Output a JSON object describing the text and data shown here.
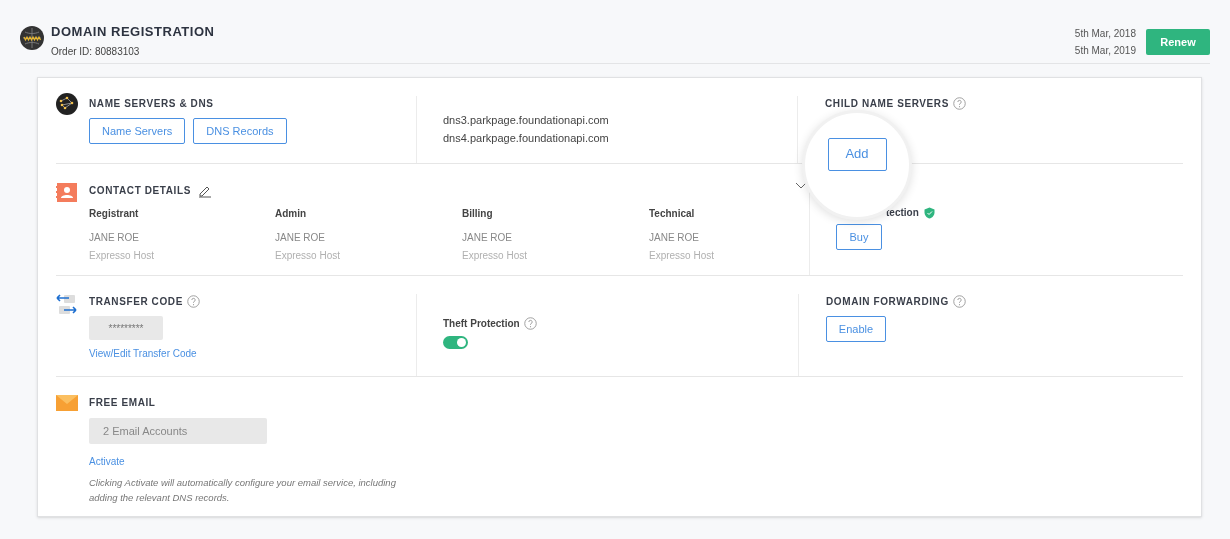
{
  "header": {
    "title": "DOMAIN REGISTRATION",
    "order_id": "Order ID: 80883103",
    "dates": [
      "5th Mar, 2018",
      "5th Mar, 2019"
    ],
    "renew_button": "Renew"
  },
  "name_servers": {
    "title": "NAME SERVERS & DNS",
    "buttons": [
      "Name Servers",
      "DNS Records"
    ],
    "servers": [
      "dns3.parkpage.foundationapi.com",
      "dns4.parkpage.foundationapi.com"
    ]
  },
  "child_name_servers": {
    "title": "CHILD NAME SERVERS",
    "button": "Add"
  },
  "contact_details": {
    "title": "CONTACT DETAILS",
    "contacts": [
      {
        "role": "Registrant",
        "name": "JANE ROE",
        "company": "Expresso Host"
      },
      {
        "role": "Admin",
        "name": "JANE ROE",
        "company": "Expresso Host"
      },
      {
        "role": "Billing",
        "name": "JANE ROE",
        "company": "Expresso Host"
      },
      {
        "role": "Technical",
        "name": "JANE ROE",
        "company": "Expresso Host"
      }
    ]
  },
  "privacy": {
    "title": "tection",
    "button": "Buy"
  },
  "transfer_code": {
    "title": "TRANSFER CODE",
    "value": "*********",
    "link": "View/Edit Transfer Code"
  },
  "theft_protection": {
    "label": "Theft Protection",
    "on": true
  },
  "domain_forwarding": {
    "title": "DOMAIN FORWARDING",
    "button": "Enable"
  },
  "free_email": {
    "title": "FREE EMAIL",
    "value": "2 Email Accounts",
    "link": "Activate",
    "note": "Clicking Activate will automatically configure your email service, including adding the relevant DNS records."
  }
}
